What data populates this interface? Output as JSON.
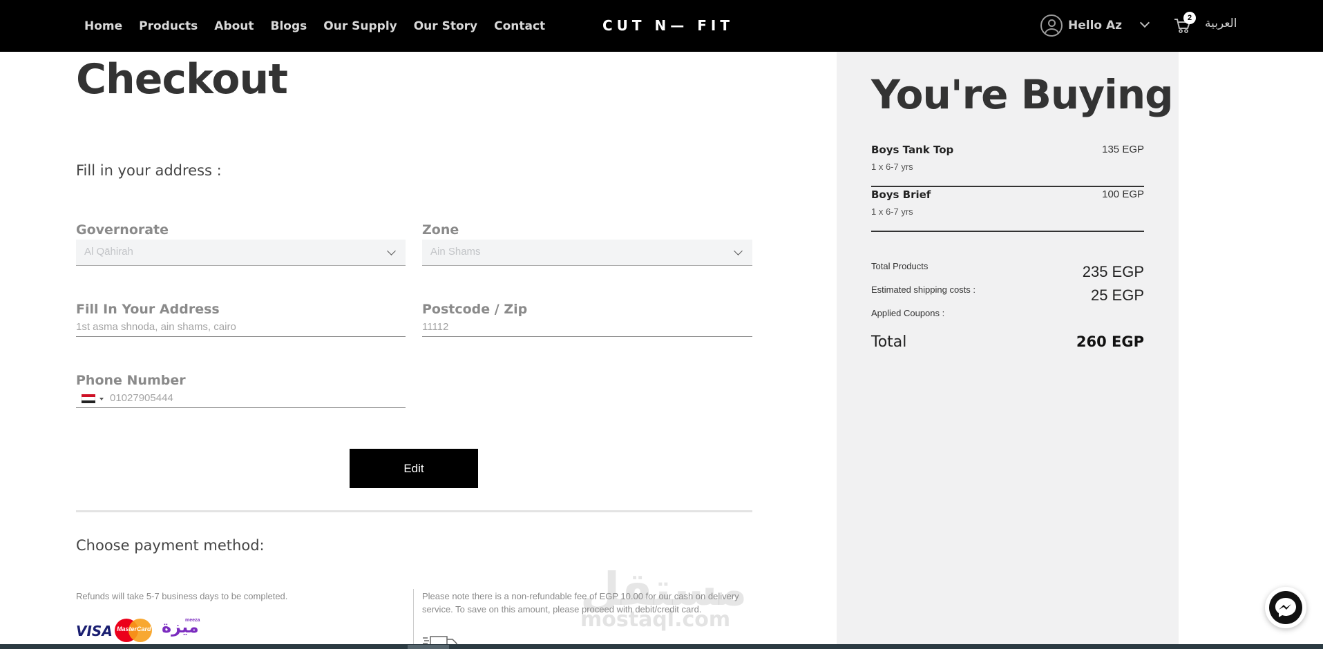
{
  "nav": {
    "links": [
      "Home",
      "Products",
      "About",
      "Blogs",
      "Our Supply",
      "Our Story",
      "Contact"
    ],
    "logo": "CUT N— FIT",
    "user_greeting": "Hello Az",
    "cart_count": "2",
    "language": "العربية"
  },
  "checkout": {
    "title": "Checkout",
    "address_heading": "Fill in your address :",
    "governorate": {
      "label": "Governorate",
      "value": "Al Qāhirah"
    },
    "zone": {
      "label": "Zone",
      "value": "Ain Shams"
    },
    "address": {
      "label": "Fill In Your Address",
      "value": "1st asma shnoda, ain shams, cairo"
    },
    "postcode": {
      "label": "Postcode / Zip",
      "value": "11112"
    },
    "phone": {
      "label": "Phone Number",
      "value": "01027905444"
    },
    "edit_label": "Edit",
    "payment_heading": "Choose payment method:",
    "refund_note": "Refunds will take 5-7 business days to be completed.",
    "cod_note": "Please note there is a non-refundable fee of EGP 10.00 for our cash on delivery service. To save on this amount, please proceed with debit/credit card.",
    "payment_logos": {
      "visa": "VISA",
      "mastercard": "MasterCard",
      "meeza": "ميزة",
      "meeza_sub": "meeza"
    }
  },
  "summary": {
    "title": "You're Buying",
    "items": [
      {
        "name": "Boys Tank Top",
        "price": "135 EGP",
        "qty": "1 x 6-7 yrs"
      },
      {
        "name": "Boys Brief",
        "price": "100 EGP",
        "qty": "1 x 6-7 yrs"
      }
    ],
    "total_products_label": "Total Products",
    "total_products_value": "235 EGP",
    "shipping_label": "Estimated shipping costs :",
    "shipping_value": "25 EGP",
    "coupons_label": "Applied Coupons :",
    "total_label": "Total",
    "total_value": "260 EGP"
  },
  "watermark": {
    "arabic": "مستقل",
    "latin": "mostaql.com"
  },
  "icons": {
    "user": "user-icon",
    "cart": "cart-icon",
    "chevron": "chevron-down-icon",
    "messenger": "messenger-icon",
    "truck": "truck-icon",
    "flag": "egypt-flag-icon"
  }
}
